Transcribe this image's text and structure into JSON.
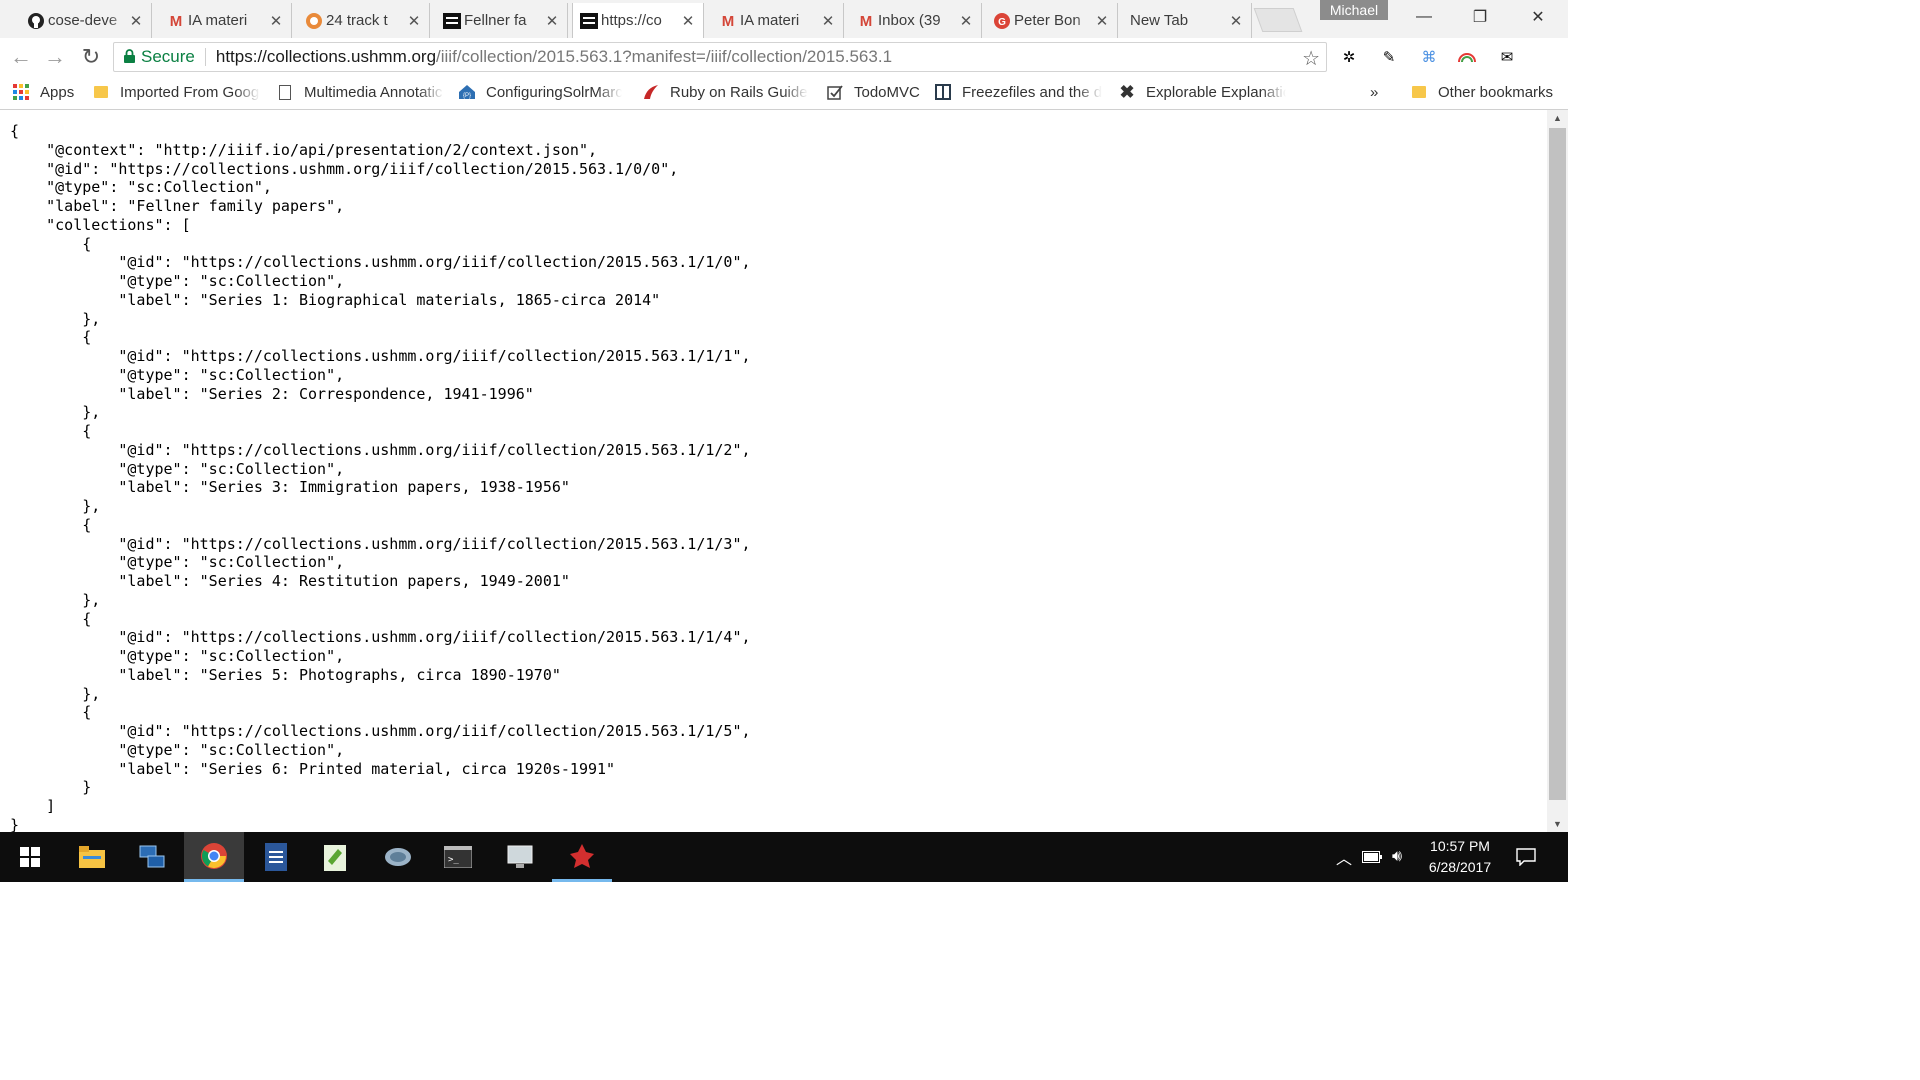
{
  "window": {
    "profile_name": "Michael",
    "tabs": [
      {
        "title": "cose-deve",
        "favicon": "github-icon",
        "active": false
      },
      {
        "title": "IA materi",
        "favicon": "gmail-icon",
        "active": false
      },
      {
        "title": "24 track t",
        "favicon": "loader-icon",
        "active": false
      },
      {
        "title": "Fellner fa",
        "favicon": "ushmm-icon",
        "active": false
      },
      {
        "title": "https://co",
        "favicon": "ushmm-icon",
        "active": true
      },
      {
        "title": "IA materi",
        "favicon": "gmail-icon",
        "active": false
      },
      {
        "title": "Inbox (39",
        "favicon": "gmail-icon",
        "active": false
      },
      {
        "title": "Peter Bon",
        "favicon": "google-plus-icon",
        "active": false
      },
      {
        "title": "New Tab",
        "favicon": "",
        "active": false
      }
    ]
  },
  "toolbar": {
    "secure_label": "Secure",
    "url_host": "https://collections.ushmm.org",
    "url_rest": "/iiif/collection/2015.563.1?manifest=/iiif/collection/2015.563.1"
  },
  "bookmarks": {
    "items": [
      {
        "label": "Apps",
        "icon": "apps-grid-icon"
      },
      {
        "label": "Imported From Goog",
        "icon": "folder-icon"
      },
      {
        "label": "Multimedia Annotatic",
        "icon": "page-icon"
      },
      {
        "label": "ConfiguringSolrMarc",
        "icon": "github-house-icon"
      },
      {
        "label": "Ruby on Rails Guides",
        "icon": "rails-icon"
      },
      {
        "label": "TodoMVC",
        "icon": "checkbox-icon"
      },
      {
        "label": "Freezefiles and the da",
        "icon": "columns-icon"
      },
      {
        "label": "Explorable Explanatio",
        "icon": "x-logo-icon"
      }
    ],
    "overflow": "»",
    "other": "Other bookmarks"
  },
  "content": {
    "json_text": "{\n    \"@context\": \"http://iiif.io/api/presentation/2/context.json\",\n    \"@id\": \"https://collections.ushmm.org/iiif/collection/2015.563.1/0/0\",\n    \"@type\": \"sc:Collection\",\n    \"label\": \"Fellner family papers\",\n    \"collections\": [\n        {\n            \"@id\": \"https://collections.ushmm.org/iiif/collection/2015.563.1/1/0\",\n            \"@type\": \"sc:Collection\",\n            \"label\": \"Series 1: Biographical materials, 1865-circa 2014\"\n        },\n        {\n            \"@id\": \"https://collections.ushmm.org/iiif/collection/2015.563.1/1/1\",\n            \"@type\": \"sc:Collection\",\n            \"label\": \"Series 2: Correspondence, 1941-1996\"\n        },\n        {\n            \"@id\": \"https://collections.ushmm.org/iiif/collection/2015.563.1/1/2\",\n            \"@type\": \"sc:Collection\",\n            \"label\": \"Series 3: Immigration papers, 1938-1956\"\n        },\n        {\n            \"@id\": \"https://collections.ushmm.org/iiif/collection/2015.563.1/1/3\",\n            \"@type\": \"sc:Collection\",\n            \"label\": \"Series 4: Restitution papers, 1949-2001\"\n        },\n        {\n            \"@id\": \"https://collections.ushmm.org/iiif/collection/2015.563.1/1/4\",\n            \"@type\": \"sc:Collection\",\n            \"label\": \"Series 5: Photographs, circa 1890-1970\"\n        },\n        {\n            \"@id\": \"https://collections.ushmm.org/iiif/collection/2015.563.1/1/5\",\n            \"@type\": \"sc:Collection\",\n            \"label\": \"Series 6: Printed material, circa 1920s-1991\"\n        }\n    ]\n}"
  },
  "taskbar": {
    "apps": [
      "windows-start-icon",
      "file-explorer-icon",
      "remote-desktop-icon",
      "chrome-icon",
      "document-icon",
      "notepad-plus-icon",
      "network-icon",
      "terminal-icon",
      "monitor-icon",
      "game-icon"
    ],
    "time": "10:57 PM",
    "date": "6/28/2017"
  },
  "colors": {
    "secure_green": "#0b8043",
    "gmail_red": "#d44638",
    "taskbar_bg": "#0d0d0d",
    "active_indicator": "#76b9ed"
  }
}
